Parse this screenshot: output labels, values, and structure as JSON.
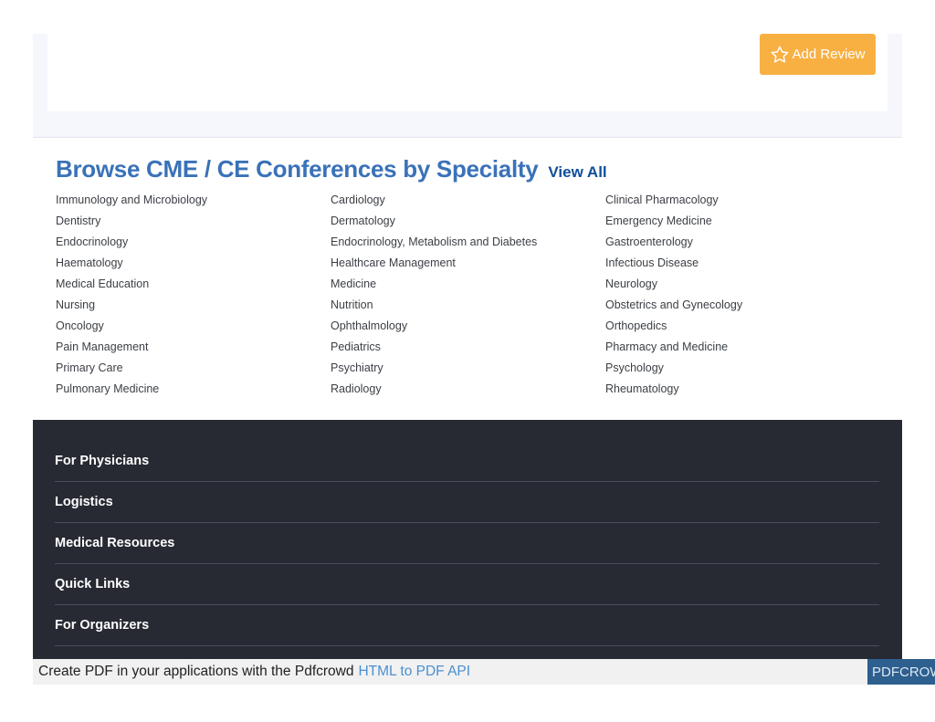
{
  "review": {
    "add_review_label": "Add Review",
    "icon": "star-outline-icon"
  },
  "browse": {
    "title": "Browse CME / CE Conferences by Specialty",
    "view_all": "View All",
    "specialties": [
      "Immunology and Microbiology",
      "Cardiology",
      "Clinical Pharmacology",
      "Dentistry",
      "Dermatology",
      "Emergency Medicine",
      "Endocrinology",
      "Endocrinology, Metabolism and Diabetes",
      "Gastroenterology",
      "Haematology",
      "Healthcare Management",
      "Infectious Disease",
      "Medical Education",
      "Medicine",
      "Neurology",
      "Nursing",
      "Nutrition",
      "Obstetrics and Gynecology",
      "Oncology",
      "Ophthalmology",
      "Orthopedics",
      "Pain Management",
      "Pediatrics",
      "Pharmacy and Medicine",
      "Primary Care",
      "Psychiatry",
      "Psychology",
      "Pulmonary Medicine",
      "Radiology",
      "Rheumatology"
    ]
  },
  "footer": {
    "sections": [
      "For Physicians",
      "Logistics",
      "Medical Resources",
      "Quick Links",
      "For Organizers"
    ]
  },
  "pdf_banner": {
    "text": "Create PDF in your applications with the Pdfcrowd",
    "link": "HTML to PDF API",
    "badge": "PDFCROWD"
  },
  "colors": {
    "accent_blue": "#3a72b8",
    "view_all_blue": "#0f4f9a",
    "review_button": "#f8b043",
    "footer_bg": "#272a33"
  }
}
